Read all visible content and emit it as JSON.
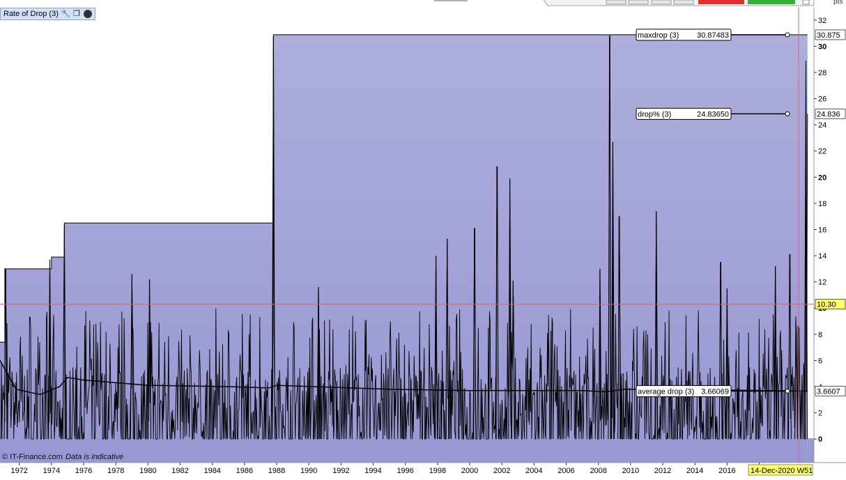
{
  "panel": {
    "title": "Rate of Drop (3)",
    "icons": [
      "wrench-icon",
      "restore-window-icon",
      "close-icon"
    ]
  },
  "credit": {
    "source": "© IT-Finance.com",
    "note": "Data is indicative"
  },
  "axis_unit": "pts",
  "crosshair": {
    "value": "10.30",
    "date_label": "14-Dec-2020 W51"
  },
  "colors": {
    "fill_top": "#aeaedc",
    "fill_bottom": "#9898d4",
    "line": "#000000",
    "crosshair": "#e06070",
    "highlight_label": "#ffff66",
    "toolbar_red": "#e03030",
    "toolbar_green": "#30b030"
  },
  "chart_data": {
    "type": "area",
    "x_ticks": [
      "1972",
      "1974",
      "1976",
      "1978",
      "1980",
      "1982",
      "1984",
      "1986",
      "1988",
      "1990",
      "1992",
      "1994",
      "1996",
      "1998",
      "2000",
      "2002",
      "2004",
      "2006",
      "2008",
      "2010",
      "2012",
      "2014",
      "2016",
      "2"
    ],
    "y_ticks": [
      "32",
      "30",
      "28",
      "26",
      "24",
      "22",
      "20",
      "18",
      "16",
      "14",
      "12",
      "10",
      "8",
      "6",
      "4",
      "2",
      "0"
    ],
    "y_bold_ticks": [
      "30",
      "20",
      "10",
      "0"
    ],
    "ylim": [
      -1.8,
      33
    ],
    "xlim": [
      1970.8,
      2021.4
    ],
    "series": [
      {
        "name": "maxdrop (3)",
        "value_label": "30.87483",
        "axis_label": "30.875",
        "steps": [
          [
            1970.8,
            7.4
          ],
          [
            1971.1,
            13.0
          ],
          [
            1974.0,
            13.9
          ],
          [
            1974.8,
            16.5
          ],
          [
            1987.8,
            30.875
          ],
          [
            2021.0,
            30.875
          ]
        ]
      },
      {
        "name": "drop% (3)",
        "value_label": "24.83650",
        "axis_label": "24.836",
        "last_value": 24.8365,
        "peaks": [
          [
            1971.15,
            13.0
          ],
          [
            1973.9,
            13.7
          ],
          [
            1974.8,
            16.4
          ],
          [
            1979.0,
            12.6
          ],
          [
            1980.1,
            12.2
          ],
          [
            1987.8,
            30.8
          ],
          [
            1990.6,
            11.6
          ],
          [
            1997.9,
            14.0
          ],
          [
            1998.6,
            15.3
          ],
          [
            2000.3,
            16.1
          ],
          [
            2001.7,
            20.8
          ],
          [
            2002.5,
            19.9
          ],
          [
            2002.7,
            12.1
          ],
          [
            2008.1,
            13.0
          ],
          [
            2008.7,
            30.8
          ],
          [
            2008.9,
            22.7
          ],
          [
            2009.3,
            17.0
          ],
          [
            2011.6,
            17.4
          ],
          [
            2015.6,
            13.5
          ],
          [
            2016.0,
            11.5
          ],
          [
            2019.0,
            13.2
          ],
          [
            2019.9,
            14.1
          ],
          [
            2020.3,
            8.3
          ],
          [
            2020.9,
            28.9
          ]
        ]
      },
      {
        "name": "average drop (3)",
        "value_label": "3.66069",
        "axis_label": "3.6607",
        "curve": [
          [
            1970.8,
            6.0
          ],
          [
            1971.8,
            3.8
          ],
          [
            1973.3,
            3.4
          ],
          [
            1974.5,
            4.0
          ],
          [
            1975.0,
            4.7
          ],
          [
            1976.0,
            4.5
          ],
          [
            1980.0,
            4.1
          ],
          [
            1985.0,
            4.0
          ],
          [
            1987.5,
            3.9
          ],
          [
            1988.0,
            4.1
          ],
          [
            1995.0,
            3.8
          ],
          [
            2000.0,
            3.7
          ],
          [
            2007.0,
            3.7
          ],
          [
            2008.5,
            3.6
          ],
          [
            2009.5,
            3.8
          ],
          [
            2012.0,
            3.8
          ],
          [
            2021.0,
            3.66
          ]
        ]
      }
    ]
  }
}
